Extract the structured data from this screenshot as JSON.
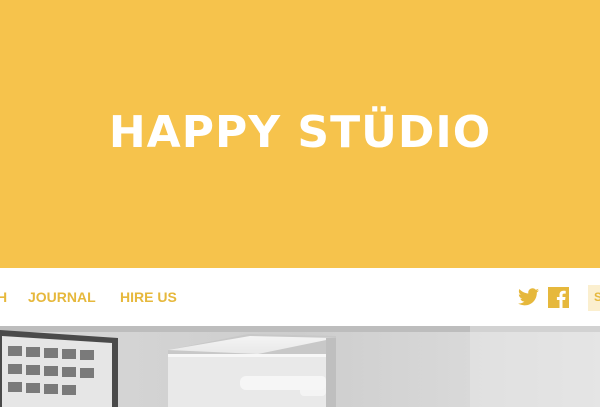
{
  "header": {
    "title": "HAPPY STÜDIO"
  },
  "nav": {
    "items": [
      {
        "label": "H"
      },
      {
        "label": "JOURNAL"
      },
      {
        "label": "HIRE US"
      }
    ],
    "subscribe_label": "S"
  },
  "social": {
    "icons": [
      "twitter-icon",
      "facebook-icon"
    ]
  },
  "colors": {
    "brand": "#F6C34C",
    "nav_text": "#E6B83C",
    "title_text": "#ffffff",
    "subscribe_bg": "#FBEFCF"
  }
}
